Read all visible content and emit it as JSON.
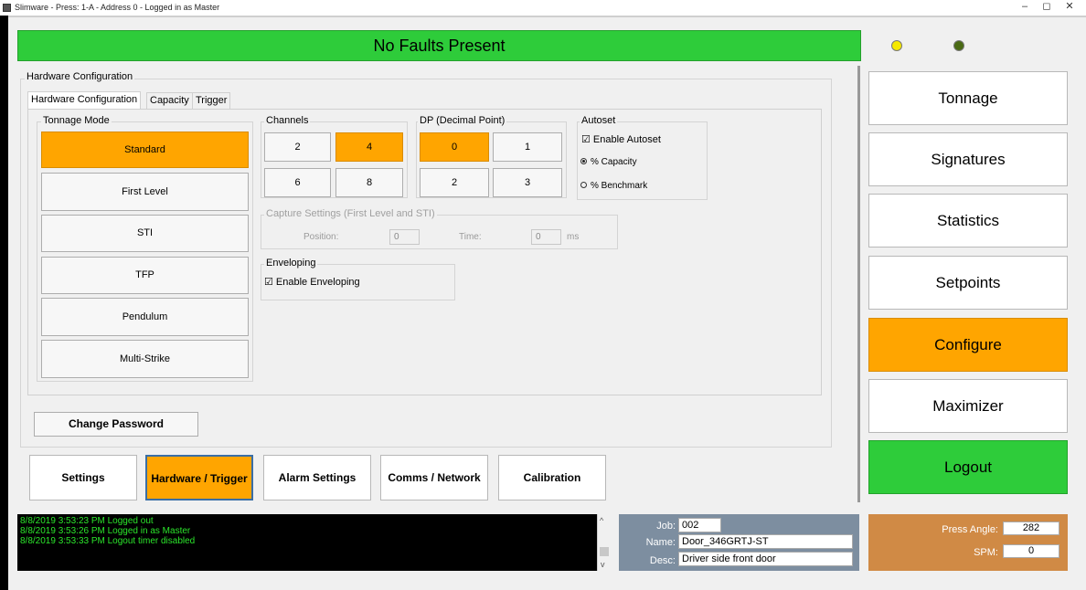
{
  "window": {
    "title": "Slimware - Press: 1-A - Address 0 - Logged in as Master",
    "minimize": "–",
    "restore": "◻",
    "close": "✕"
  },
  "status": {
    "fault_text": "No Faults Present"
  },
  "indicators": {
    "led1_color": "#f5e800",
    "led2_color": "#4a6a14"
  },
  "nav": {
    "items": [
      {
        "label": "Tonnage"
      },
      {
        "label": "Signatures"
      },
      {
        "label": "Statistics"
      },
      {
        "label": "Setpoints"
      },
      {
        "label": "Configure",
        "active": true
      },
      {
        "label": "Maximizer"
      },
      {
        "label": "Logout"
      }
    ]
  },
  "hw": {
    "outer_title": "Hardware Configuration",
    "tabs": [
      "Hardware Configuration",
      "Capacity",
      "Trigger"
    ],
    "tonnage_mode": {
      "title": "Tonnage Mode",
      "options": [
        "Standard",
        "First Level",
        "STI",
        "TFP",
        "Pendulum",
        "Multi-Strike"
      ],
      "selected": "Standard"
    },
    "channels": {
      "title": "Channels",
      "options": [
        "2",
        "4",
        "6",
        "8"
      ],
      "selected": "4"
    },
    "dp": {
      "title": "DP (Decimal Point)",
      "options": [
        "0",
        "1",
        "2",
        "3"
      ],
      "selected": "0"
    },
    "autoset": {
      "title": "Autoset",
      "enable_label": "☑ Enable Autoset",
      "radio1": "% Capacity",
      "radio2": "% Benchmark"
    },
    "capture": {
      "title": "Capture Settings (First Level and STI)",
      "position_label": "Position:",
      "position_value": "0",
      "time_label": "Time:",
      "time_value": "0",
      "time_unit": "ms"
    },
    "enveloping": {
      "title": "Enveloping",
      "enable_label": "☑ Enable Enveloping"
    },
    "change_password": "Change Password"
  },
  "bottom_tabs": [
    "Settings",
    "Hardware / Trigger",
    "Alarm Settings",
    "Comms / Network",
    "Calibration"
  ],
  "log": {
    "lines": [
      "8/8/2019 3:53:23 PM  Logged out",
      "8/8/2019 3:53:26 PM  Logged in as Master",
      "8/8/2019 3:53:33 PM  Logout timer disabled"
    ],
    "scroll_up": "^",
    "scroll_down": "v"
  },
  "job": {
    "job_label": "Job:",
    "job_value": "002",
    "name_label": "Name:",
    "name_value": "Door_346GRTJ-ST",
    "desc_label": "Desc:",
    "desc_value": "Driver side front door"
  },
  "press": {
    "angle_label": "Press Angle:",
    "angle_value": "282",
    "spm_label": "SPM:",
    "spm_value": "0"
  }
}
